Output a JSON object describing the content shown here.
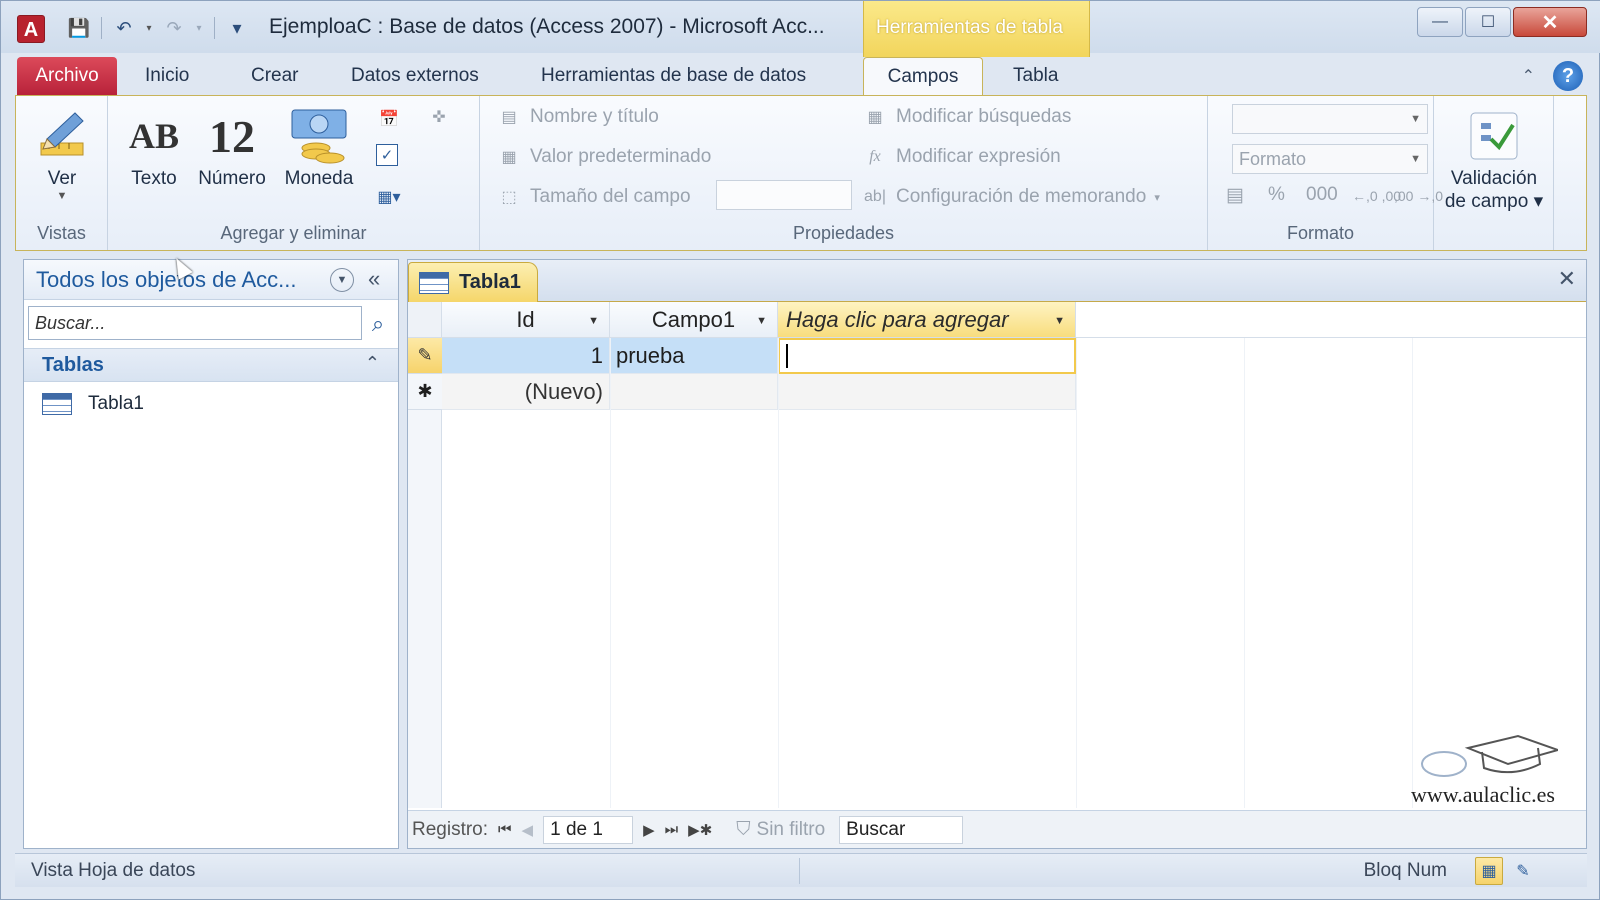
{
  "window": {
    "app_icon_label": "A",
    "title": "EjemploaC : Base de datos (Access 2007)  -  Microsoft Acc...",
    "context_tools": "Herramientas de tabla",
    "controls": {
      "minimize": "—",
      "maximize": "☐",
      "close": "✕"
    }
  },
  "qat": {
    "save": "💾",
    "undo": "↶",
    "redo": "↷",
    "customize": "▾"
  },
  "tabs": {
    "file": "Archivo",
    "items": [
      "Inicio",
      "Crear",
      "Datos externos",
      "Herramientas de base de datos",
      "Campos",
      "Tabla"
    ],
    "active": "Campos"
  },
  "ribbon": {
    "vistas": {
      "label": "Vistas",
      "ver": "Ver"
    },
    "agregar": {
      "label": "Agregar y eliminar",
      "texto_icon": "AB",
      "texto": "Texto",
      "numero_icon": "12",
      "numero": "Número",
      "moneda": "Moneda"
    },
    "propiedades": {
      "label": "Propiedades",
      "nombre_titulo": "Nombre y título",
      "valor_predeterminado": "Valor predeterminado",
      "tamano_campo": "Tamaño del campo",
      "modificar_busquedas": "Modificar búsquedas",
      "modificar_expresion": "Modificar expresión",
      "config_memorando": "Configuración de memorando"
    },
    "formato": {
      "label": "Formato",
      "formato_combo": "Formato",
      "percent": "%",
      "thousands": "000",
      "inc_dec": "←,0 ,00",
      "dec_dec": ",00 →,0"
    },
    "validacion": {
      "line1": "Validación",
      "line2": "de campo ▾"
    }
  },
  "nav": {
    "title": "Todos los objetos de Acc...",
    "search_placeholder": "Buscar...",
    "group": "Tablas",
    "items": [
      "Tabla1"
    ]
  },
  "doc": {
    "tab": "Tabla1",
    "columns": {
      "id": "Id",
      "campo1": "Campo1",
      "add": "Haga clic para agregar"
    },
    "rows": [
      {
        "id": "1",
        "campo1": "prueba"
      }
    ],
    "new_row": "(Nuevo)",
    "record_nav": {
      "label": "Registro:",
      "current": "1 de 1",
      "filter": "Sin filtro",
      "search": "Buscar"
    }
  },
  "watermark": "www.aulaclic.es",
  "status": {
    "left": "Vista Hoja de datos",
    "numlock": "Bloq Num"
  }
}
